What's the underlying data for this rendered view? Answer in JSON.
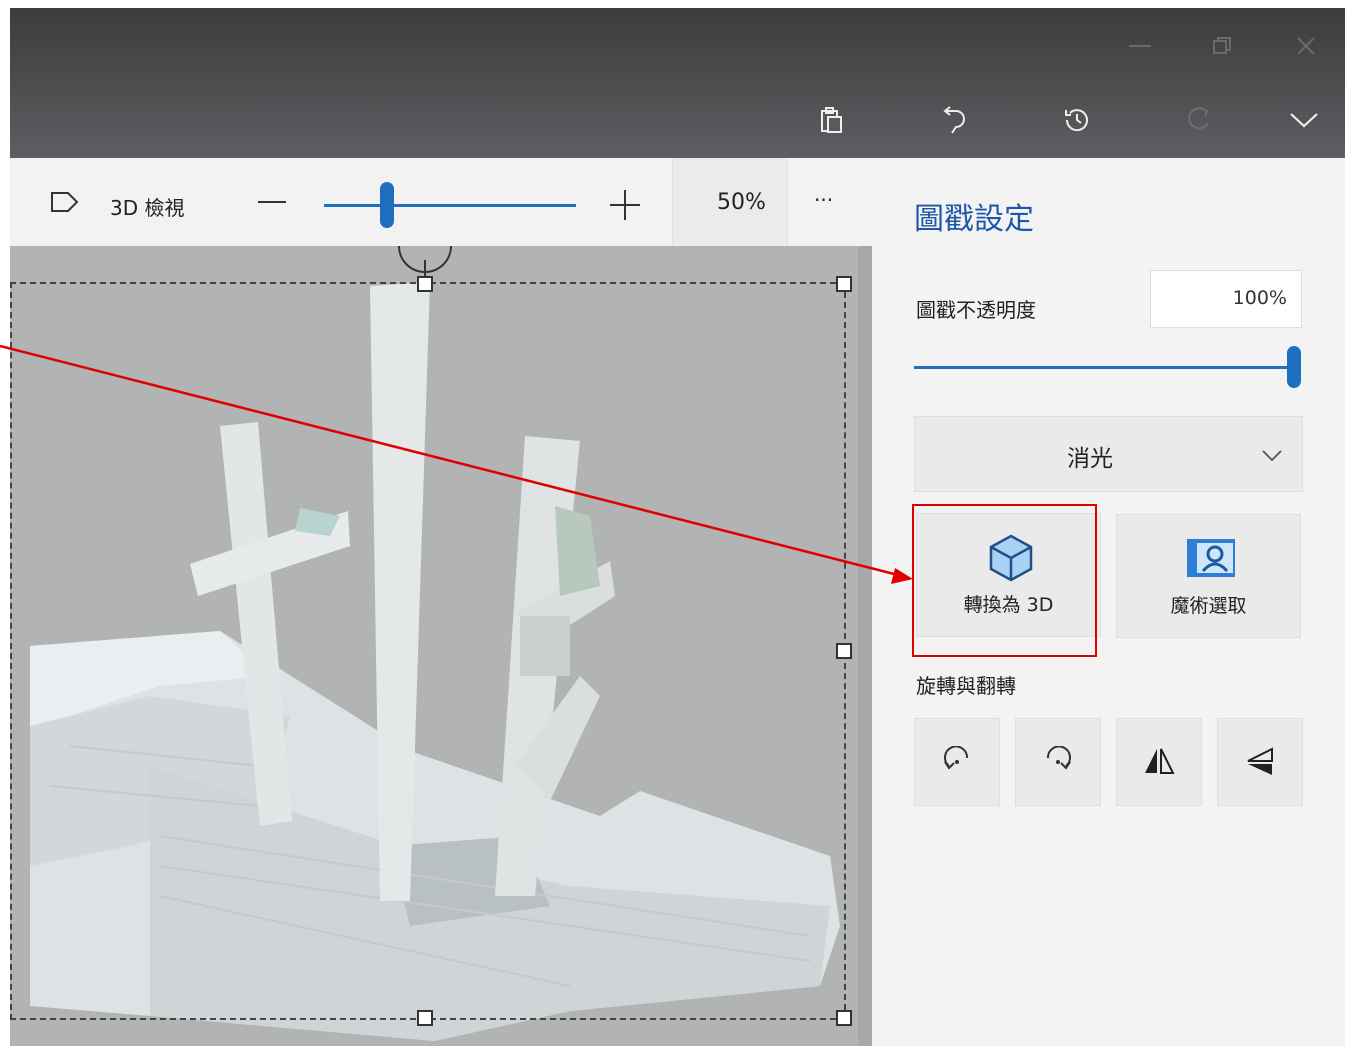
{
  "toolbar": {
    "view3d_label": "3D 檢視",
    "zoom_value": "50%",
    "zoom_level": 0.25,
    "more_label": "···"
  },
  "panel": {
    "title": "圖戳設定",
    "opacity_label": "圖戳不透明度",
    "opacity_value": "100%",
    "opacity_fraction": 1.0,
    "finish_value": "消光",
    "convert_label": "轉換為 3D",
    "magic_label": "魔術選取",
    "rotate_label": "旋轉與翻轉"
  },
  "colors": {
    "accent": "#1f6fc0",
    "annotation": "#e00000",
    "titlebar": "#4a4a4c"
  },
  "icons": [
    "minimize-icon",
    "restore-icon",
    "close-icon",
    "paste-icon",
    "undo-icon",
    "history-icon",
    "redo-icon",
    "chevron-down-icon",
    "view-3d-icon",
    "zoom-out-icon",
    "zoom-in-icon",
    "cube-icon",
    "magic-select-icon",
    "rotate-left-icon",
    "rotate-right-icon",
    "flip-horizontal-icon",
    "flip-vertical-icon"
  ]
}
